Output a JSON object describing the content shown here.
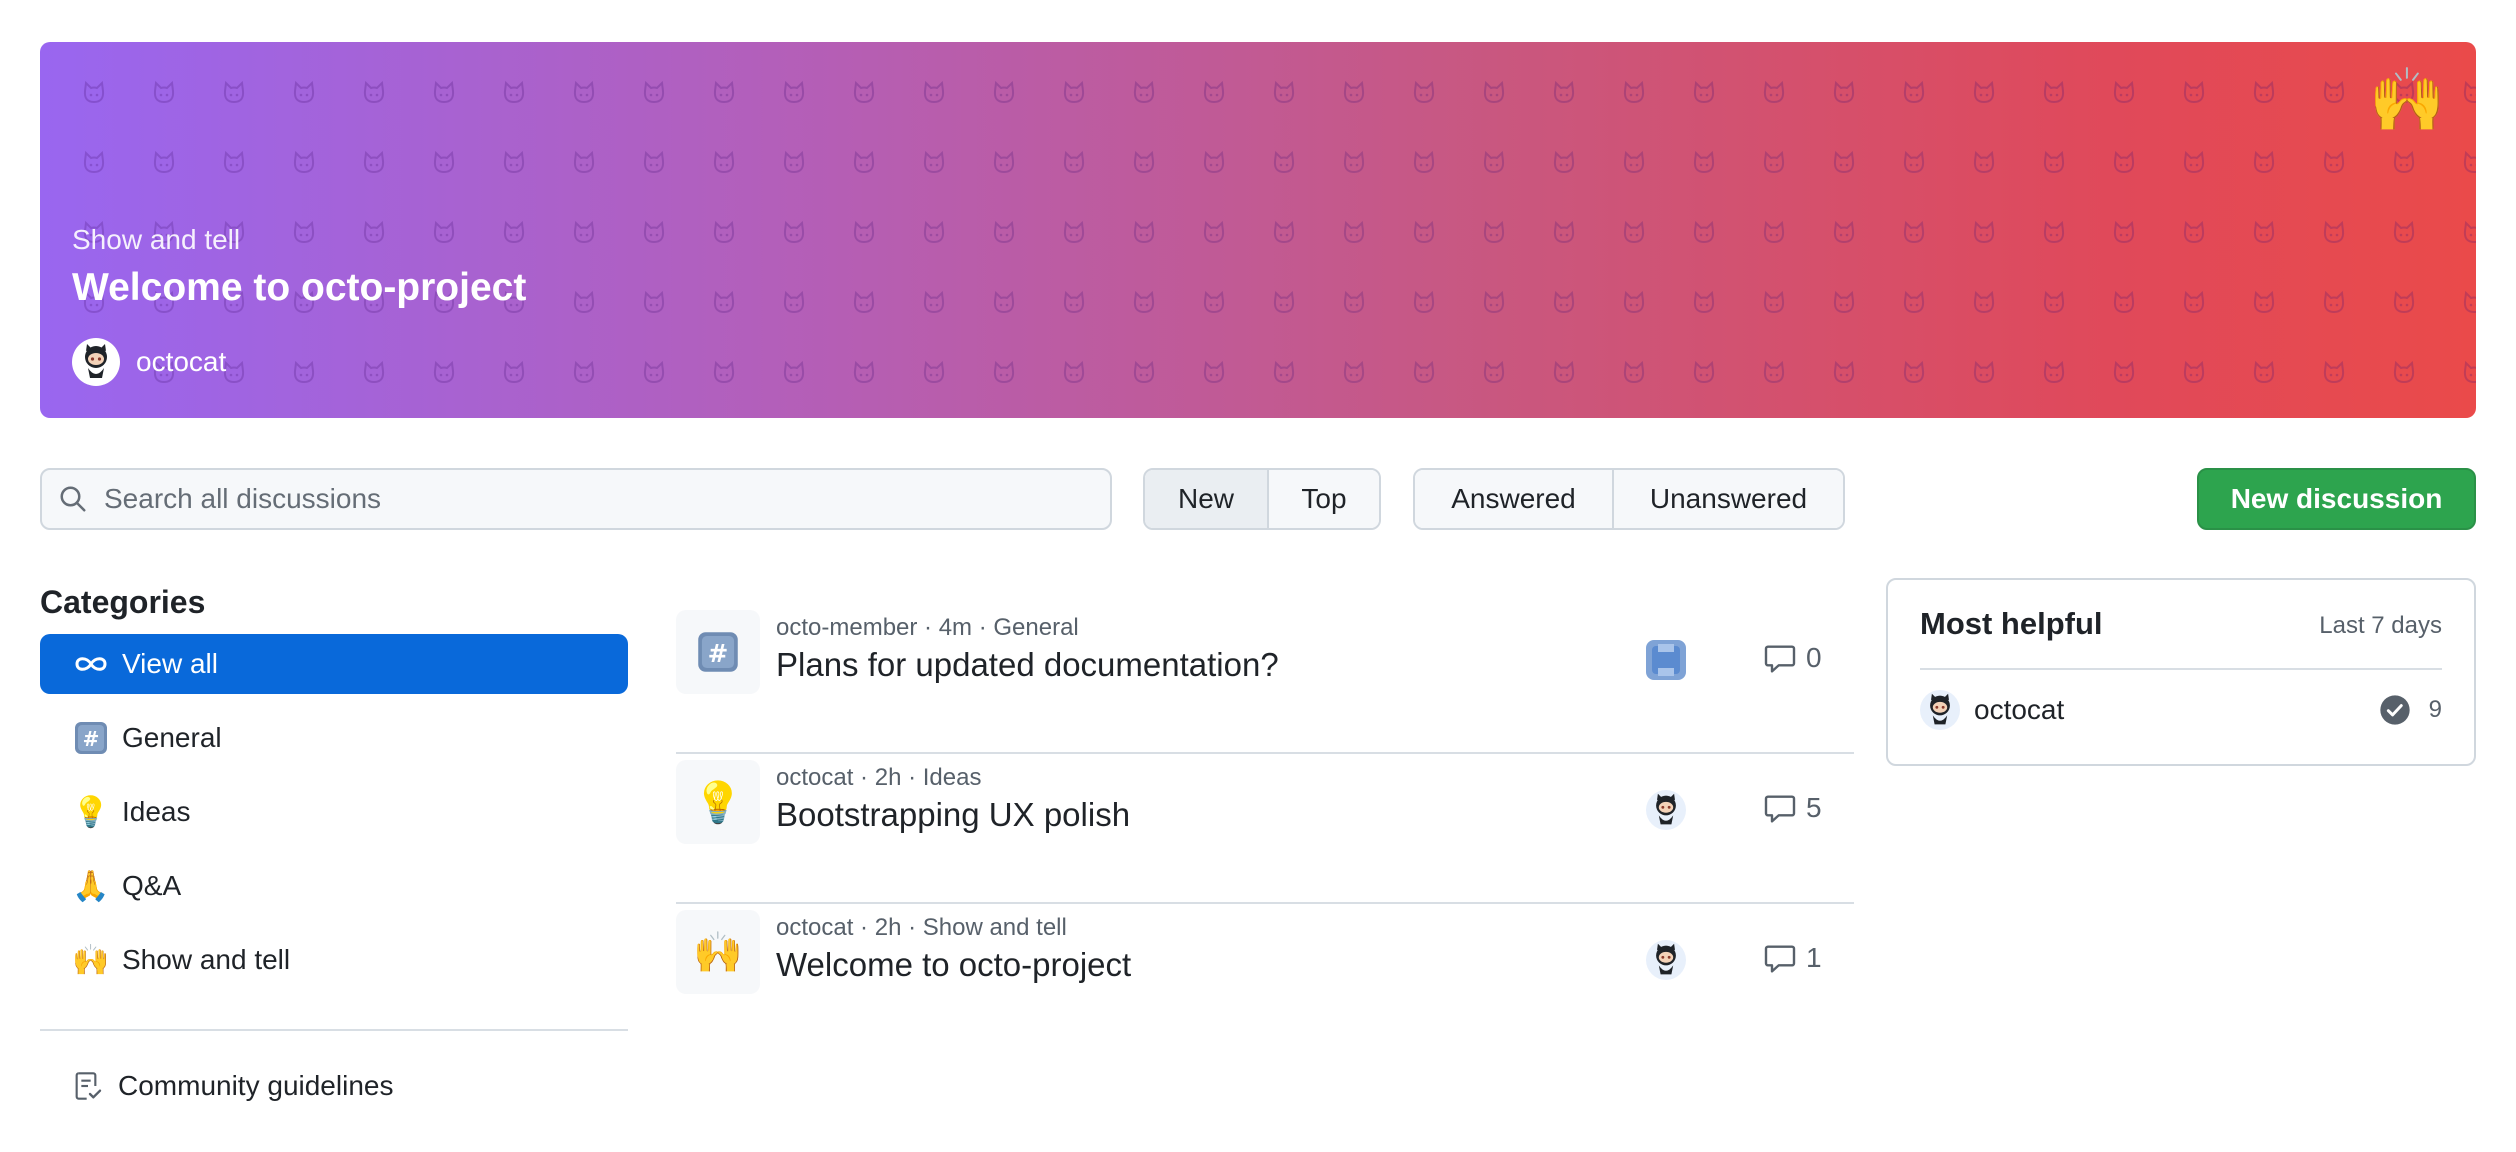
{
  "hero": {
    "category": "Show and tell",
    "title": "Welcome to octo-project",
    "author": "octocat",
    "emoji": "🙌"
  },
  "toolbar": {
    "search_placeholder": "Search all discussions",
    "sort_options": [
      {
        "label": "New",
        "selected": true
      },
      {
        "label": "Top",
        "selected": false
      }
    ],
    "filter_options": [
      {
        "label": "Answered"
      },
      {
        "label": "Unanswered"
      }
    ],
    "new_discussion_label": "New discussion"
  },
  "sidebar": {
    "heading": "Categories",
    "items": [
      {
        "label": "View all",
        "icon": "infinity-icon",
        "active": true
      },
      {
        "label": "General",
        "icon": "hash-keycap-icon",
        "active": false
      },
      {
        "label": "Ideas",
        "icon": "lightbulb-icon",
        "active": false
      },
      {
        "label": "Q&A",
        "icon": "folded-hands-icon",
        "active": false
      },
      {
        "label": "Show and tell",
        "icon": "raising-hands-icon",
        "active": false
      }
    ],
    "guidelines_label": "Community guidelines"
  },
  "discussions": [
    {
      "author": "octo-member",
      "time": "4m",
      "category": "General",
      "title": "Plans for updated documentation?",
      "comments": "0",
      "icon": "hash-keycap-icon"
    },
    {
      "author": "octocat",
      "time": "2h",
      "category": "Ideas",
      "title": "Bootstrapping UX polish",
      "comments": "5",
      "icon": "lightbulb-icon"
    },
    {
      "author": "octocat",
      "time": "2h",
      "category": "Show and tell",
      "title": "Welcome to octo-project",
      "comments": "1",
      "icon": "raising-hands-icon"
    }
  ],
  "most_helpful": {
    "title": "Most helpful",
    "range": "Last 7 days",
    "users": [
      {
        "name": "octocat",
        "score": "9"
      }
    ]
  },
  "colors": {
    "accent_blue": "#0969da",
    "primary_green": "#2da44e",
    "hero_gradient_start": "#9966f0",
    "hero_gradient_end": "#ea4a4a"
  }
}
